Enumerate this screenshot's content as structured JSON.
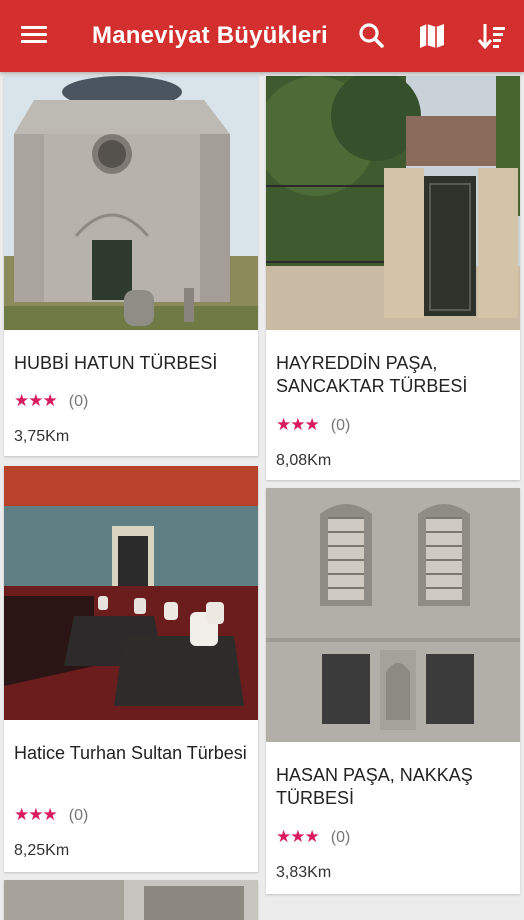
{
  "app": {
    "title": "Maneviyat Büyükleri"
  },
  "toolbar": {
    "menu_icon": "menu-icon",
    "search_icon": "search-icon",
    "map_icon": "map-icon",
    "sort_icon": "sort-icon"
  },
  "places": [
    {
      "name": "HUBBİ HATUN TÜRBESİ",
      "stars": "★★★",
      "count": "(0)",
      "distance": "3,75Km"
    },
    {
      "name": "HAYREDDİN PAŞA, SANCAKTAR TÜRBESİ",
      "stars": "★★★",
      "count": "(0)",
      "distance": "8,08Km"
    },
    {
      "name": "Hatice Turhan Sultan Türbesi",
      "stars": "★★★",
      "count": "(0)",
      "distance": "8,25Km"
    },
    {
      "name": "HASAN PAŞA, NAKKAŞ TÜRBESİ",
      "stars": "★★★",
      "count": "(0)",
      "distance": "3,83Km"
    }
  ],
  "colors": {
    "primary": "#d32f2f",
    "star": "#d81b60",
    "background": "#ececec"
  }
}
